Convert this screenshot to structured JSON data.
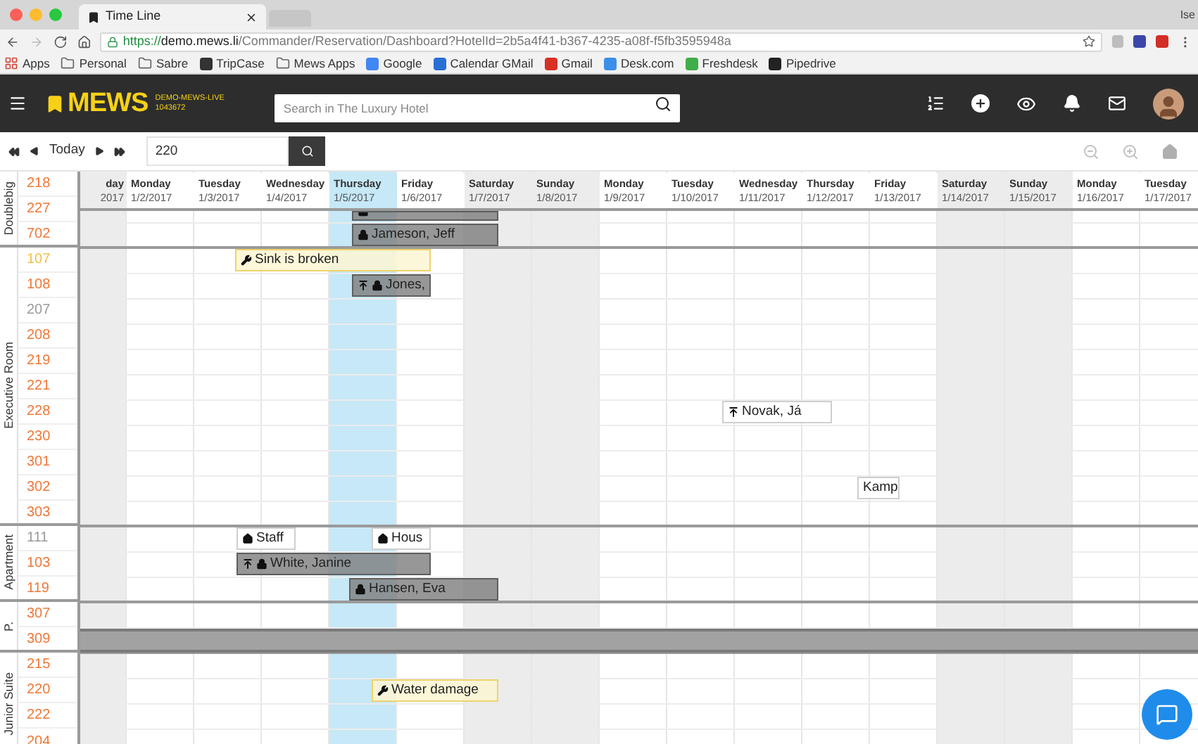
{
  "browser": {
    "tab_title": "Time Line",
    "user": "Ise",
    "url_scheme": "https://",
    "url_host": "demo.mews.li",
    "url_path": "/Commander/Reservation/Dashboard?HotelId=2b5a4f41-b367-4235-a08f-f5fb3595948a",
    "bookmarks": [
      {
        "kind": "apps",
        "label": "Apps"
      },
      {
        "kind": "folder",
        "label": "Personal"
      },
      {
        "kind": "folder",
        "label": "Sabre"
      },
      {
        "kind": "site",
        "label": "TripCase",
        "color": "#333333"
      },
      {
        "kind": "folder",
        "label": "Mews Apps"
      },
      {
        "kind": "site",
        "label": "Google",
        "color": "#4285f4"
      },
      {
        "kind": "site",
        "label": "Calendar GMail",
        "color": "#2a6fd6"
      },
      {
        "kind": "site",
        "label": "Gmail",
        "color": "#d93025"
      },
      {
        "kind": "site",
        "label": "Desk.com",
        "color": "#3c8ee8"
      },
      {
        "kind": "site",
        "label": "Freshdesk",
        "color": "#3fae49"
      },
      {
        "kind": "site",
        "label": "Pipedrive",
        "color": "#222222"
      }
    ]
  },
  "header": {
    "logo": "MEWS",
    "env_name": "DEMO-MEWS-LIVE",
    "env_id": "1043672",
    "search_placeholder": "Search in The Luxury Hotel"
  },
  "toolbar": {
    "today": "Today",
    "room_search_value": "220"
  },
  "days": [
    {
      "name": "day",
      "date": "2017",
      "weekend": true,
      "selected": false
    },
    {
      "name": "Monday",
      "date": "1/2/2017",
      "weekend": false,
      "selected": false
    },
    {
      "name": "Tuesday",
      "date": "1/3/2017",
      "weekend": false,
      "selected": false
    },
    {
      "name": "Wednesday",
      "date": "1/4/2017",
      "weekend": false,
      "selected": false
    },
    {
      "name": "Thursday",
      "date": "1/5/2017",
      "weekend": false,
      "selected": true
    },
    {
      "name": "Friday",
      "date": "1/6/2017",
      "weekend": false,
      "selected": false
    },
    {
      "name": "Saturday",
      "date": "1/7/2017",
      "weekend": true,
      "selected": false
    },
    {
      "name": "Sunday",
      "date": "1/8/2017",
      "weekend": true,
      "selected": false
    },
    {
      "name": "Monday",
      "date": "1/9/2017",
      "weekend": false,
      "selected": false
    },
    {
      "name": "Tuesday",
      "date": "1/10/2017",
      "weekend": false,
      "selected": false
    },
    {
      "name": "Wednesday",
      "date": "1/11/2017",
      "weekend": false,
      "selected": false
    },
    {
      "name": "Thursday",
      "date": "1/12/2017",
      "weekend": false,
      "selected": false
    },
    {
      "name": "Friday",
      "date": "1/13/2017",
      "weekend": false,
      "selected": false
    },
    {
      "name": "Saturday",
      "date": "1/14/2017",
      "weekend": true,
      "selected": false
    },
    {
      "name": "Sunday",
      "date": "1/15/2017",
      "weekend": true,
      "selected": false
    },
    {
      "name": "Monday",
      "date": "1/16/2017",
      "weekend": false,
      "selected": false
    },
    {
      "name": "Tuesday",
      "date": "1/17/2017",
      "weekend": false,
      "selected": false
    }
  ],
  "groups": [
    {
      "name": "Doublebig",
      "rooms": [
        {
          "number": "218",
          "color": "#f07838"
        },
        {
          "number": "227",
          "color": "#f07838"
        },
        {
          "number": "702",
          "color": "#f07838"
        }
      ]
    },
    {
      "name": "Executive Room",
      "rooms": [
        {
          "number": "107",
          "color": "#f2c04a"
        },
        {
          "number": "108",
          "color": "#f07838"
        },
        {
          "number": "207",
          "color": "#9a9a9a"
        },
        {
          "number": "208",
          "color": "#f07838"
        },
        {
          "number": "219",
          "color": "#f07838"
        },
        {
          "number": "221",
          "color": "#f07838"
        },
        {
          "number": "228",
          "color": "#f07838"
        },
        {
          "number": "230",
          "color": "#f07838"
        },
        {
          "number": "301",
          "color": "#f07838"
        },
        {
          "number": "302",
          "color": "#f07838"
        },
        {
          "number": "303",
          "color": "#f07838"
        }
      ]
    },
    {
      "name": "Apartment",
      "rooms": [
        {
          "number": "111",
          "color": "#9a9a9a"
        },
        {
          "number": "103",
          "color": "#f07838"
        },
        {
          "number": "119",
          "color": "#f07838"
        }
      ]
    },
    {
      "name": "P.",
      "rooms": [
        {
          "number": "307",
          "color": "#f07838"
        },
        {
          "number": "309",
          "color": "#f07838"
        }
      ]
    },
    {
      "name": "Junior Suite",
      "rooms": [
        {
          "number": "215",
          "color": "#f07838"
        },
        {
          "number": "220",
          "color": "#f07838"
        },
        {
          "number": "222",
          "color": "#f07838"
        },
        {
          "number": "204",
          "color": "#f07838"
        }
      ]
    }
  ],
  "events": [
    {
      "kind": "booking",
      "locked": true,
      "arriving": false,
      "partial": true
    },
    {
      "kind": "booking",
      "label": "Jameson, Jeff",
      "locked": true,
      "arriving": false
    },
    {
      "kind": "maintenance",
      "label": "Sink is broken",
      "locked": false,
      "arriving": false
    },
    {
      "kind": "booking",
      "label": "Jones,",
      "locked": true,
      "arriving": true
    },
    {
      "kind": "reservation",
      "label": "Novak, Já",
      "locked": false,
      "arriving": true
    },
    {
      "kind": "reservation",
      "label": "Kamp",
      "locked": false,
      "arriving": false
    },
    {
      "kind": "housekeeping",
      "label": "Staff",
      "locked": false,
      "arriving": false
    },
    {
      "kind": "housekeeping",
      "label": "Hous",
      "locked": false,
      "arriving": false
    },
    {
      "kind": "booking",
      "label": "White, Janine",
      "locked": true,
      "arriving": true
    },
    {
      "kind": "booking",
      "label": "Hansen, Eva",
      "locked": true,
      "arriving": false
    },
    {
      "kind": "blocked"
    },
    {
      "kind": "maintenance",
      "label": "Water damage",
      "locked": false,
      "arriving": false
    }
  ]
}
